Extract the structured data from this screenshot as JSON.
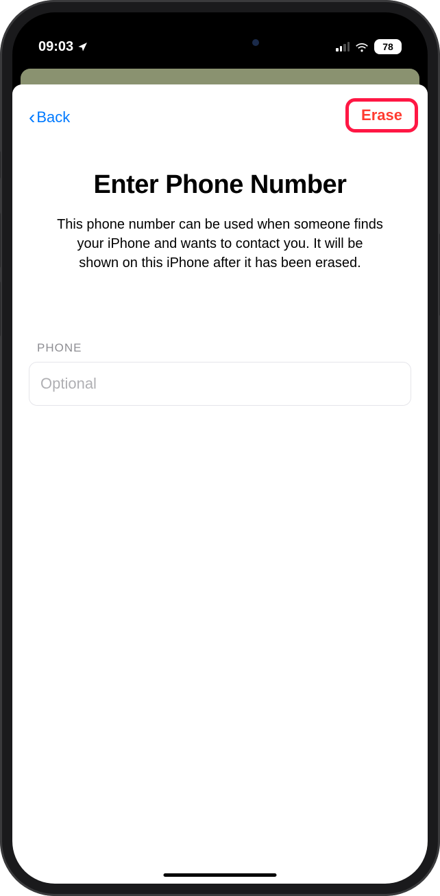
{
  "status_bar": {
    "time": "09:03",
    "battery_level": "78"
  },
  "nav": {
    "back_label": "Back",
    "erase_label": "Erase"
  },
  "content": {
    "title": "Enter Phone Number",
    "description": "This phone number can be used when someone finds your iPhone and wants to contact you. It will be shown on this iPhone after it has been erased."
  },
  "form": {
    "phone_label": "PHONE",
    "phone_placeholder": "Optional",
    "phone_value": ""
  }
}
